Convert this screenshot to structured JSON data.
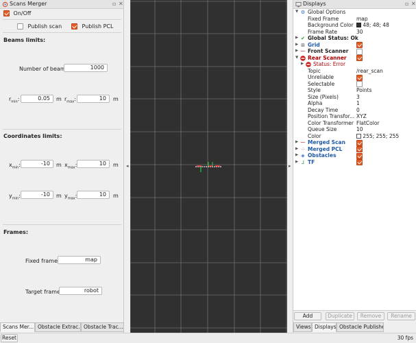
{
  "left_panel": {
    "title": "Scans Merger",
    "on_off": {
      "label": "On/Off",
      "checked": true
    },
    "publish_scan": {
      "label": "Publish scan",
      "checked": false
    },
    "publish_pcl": {
      "label": "Publish PCL",
      "checked": true
    },
    "beams": {
      "heading": "Beams limits:",
      "num_beams_label": "Number of beams:",
      "num_beams_value": "1000",
      "r_min_label": "r",
      "r_min_sub": "min",
      "r_min_value": "0.05",
      "r_max_label": "r",
      "r_max_sub": "max",
      "r_max_value": "10",
      "unit": "m"
    },
    "coords": {
      "heading": "Coordinates limits:",
      "x_min_label": "x",
      "x_min_sub": "min",
      "x_min_value": "-10",
      "x_max_label": "x",
      "x_max_sub": "max",
      "x_max_value": "10",
      "y_min_label": "y",
      "y_min_sub": "min",
      "y_min_value": "-10",
      "y_max_label": "y",
      "y_max_sub": "max",
      "y_max_value": "10",
      "unit": "m"
    },
    "frames": {
      "heading": "Frames:",
      "fixed_label": "Fixed frame:",
      "fixed_value": "map",
      "target_label": "Target frame:",
      "target_value": "robot"
    },
    "tabs": [
      "Scans Mer...",
      "Obstacle Extrac...",
      "Obstacle Trac..."
    ]
  },
  "displays": {
    "title": "Displays",
    "items": {
      "global_options": "Global Options",
      "fixed_frame": {
        "name": "Fixed Frame",
        "value": "map"
      },
      "background_color": {
        "name": "Background Color",
        "value": "48; 48; 48",
        "swatch": "#303030"
      },
      "frame_rate": {
        "name": "Frame Rate",
        "value": "30"
      },
      "global_status": "Global Status: Ok",
      "grid": "Grid",
      "front_scanner": "Front Scanner",
      "rear_scanner": "Rear Scanner",
      "status_error": "Status: Error",
      "topic": {
        "name": "Topic",
        "value": "/rear_scan"
      },
      "unreliable": {
        "name": "Unreliable"
      },
      "selectable": {
        "name": "Selectable"
      },
      "style": {
        "name": "Style",
        "value": "Points"
      },
      "size": {
        "name": "Size (Pixels)",
        "value": "3"
      },
      "alpha": {
        "name": "Alpha",
        "value": "1"
      },
      "decay": {
        "name": "Decay Time",
        "value": "0"
      },
      "position_transformer": {
        "name": "Position Transfor...",
        "value": "XYZ"
      },
      "color_transformer": {
        "name": "Color Transformer",
        "value": "FlatColor"
      },
      "queue_size": {
        "name": "Queue Size",
        "value": "10"
      },
      "color": {
        "name": "Color",
        "value": "255; 255; 255",
        "swatch": "#ffffff"
      },
      "merged_scan": "Merged Scan",
      "merged_pcl": "Merged PCL",
      "obstacles": "Obstacles",
      "tf": "TF"
    },
    "buttons": {
      "add": "Add",
      "duplicate": "Duplicate",
      "remove": "Remove",
      "rename": "Rename"
    },
    "tabs": [
      "Views",
      "Displays",
      "Obstacle Publisher"
    ]
  },
  "status_bar": {
    "reset": "Reset",
    "fps": "30 fps"
  },
  "colors": {
    "accent": "#e65a24",
    "viewport_bg": "#303030",
    "blue": "#1e5aa8",
    "error": "#b00000"
  }
}
